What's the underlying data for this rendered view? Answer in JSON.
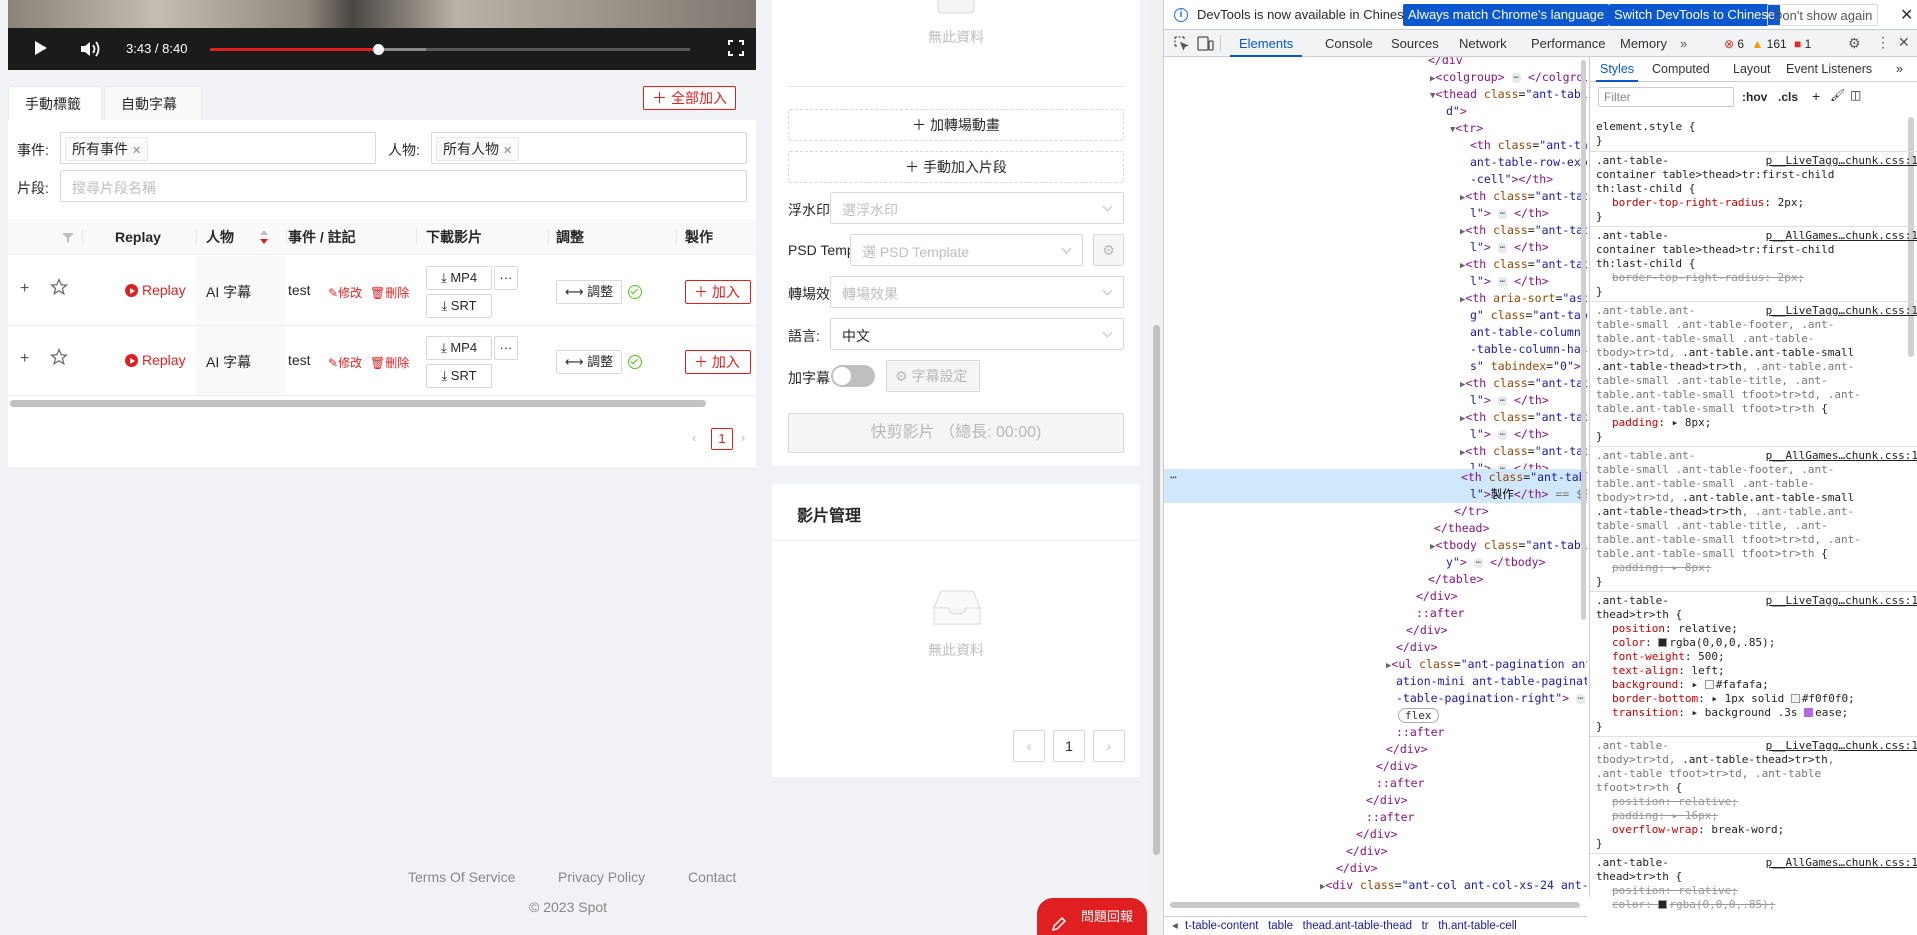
{
  "video": {
    "time": "3:43 / 8:40",
    "played_fraction": 0.35,
    "buffered_fraction": 0.45
  },
  "tabs": [
    "手動標籤",
    "自動字幕"
  ],
  "add_all_label": "全部加入",
  "filters": {
    "event_label": "事件:",
    "event_tag": "所有事件",
    "person_label": "人物:",
    "person_tag": "所有人物",
    "clip_label": "片段:",
    "clip_placeholder": "搜尋片段名稱"
  },
  "table": {
    "headers": [
      "Replay",
      "人物",
      "事件 / 註記",
      "下載影片",
      "調整",
      "製作"
    ],
    "rows": [
      {
        "replay": "Replay",
        "person": "AI 字幕",
        "event": "test",
        "edit": "修改",
        "delete": "刪除",
        "mp4": "MP4",
        "srt": "SRT",
        "adjust": "調整",
        "add": "加入"
      },
      {
        "replay": "Replay",
        "person": "AI 字幕",
        "event": "test",
        "edit": "修改",
        "delete": "刪除",
        "mp4": "MP4",
        "srt": "SRT",
        "adjust": "調整",
        "add": "加入"
      }
    ],
    "page": "1"
  },
  "middle": {
    "no_data_top": "無此資料",
    "add_transition": "加轉場動畫",
    "add_clip": "手動加入片段",
    "watermark_label": "浮水印",
    "watermark_placeholder": "選浮水印",
    "psd_label": "PSD Temp",
    "psd_placeholder": "選 PSD Template",
    "transition_label": "轉場效",
    "transition_placeholder": "轉場效果",
    "language_label": "語言:",
    "language_value": "中文",
    "subtitle_label": "加字幕",
    "subtitle_settings": "字幕設定",
    "quick_cut": "快剪影片 （總長: 00:00)",
    "video_mgmt_title": "影片管理",
    "no_data_bottom": "無此資料",
    "page": "1"
  },
  "footer": {
    "links": [
      "Terms Of Service",
      "Privacy Policy",
      "Contact"
    ],
    "copyright": "© 2023 Spot",
    "feedback": "問題回報"
  },
  "devtools": {
    "info_text": "DevTools is now available in Chinese!",
    "btn_match": "Always match Chrome's language",
    "btn_switch": "Switch DevTools to Chinese",
    "btn_dont": "Don't show again",
    "tabs": [
      "Elements",
      "Console",
      "Sources",
      "Network",
      "Performance",
      "Memory"
    ],
    "errors": "6",
    "warnings": "161",
    "issues": "1",
    "style_tabs": [
      "Styles",
      "Computed",
      "Layout",
      "Event Listeners"
    ],
    "filter_placeholder": "Filter",
    "hov": ":hov",
    "cls": ".cls",
    "breadcrumbs": [
      "t-table-content",
      "table",
      "thead.ant-table-thead",
      "tr",
      "th.ant-table-cell"
    ]
  }
}
